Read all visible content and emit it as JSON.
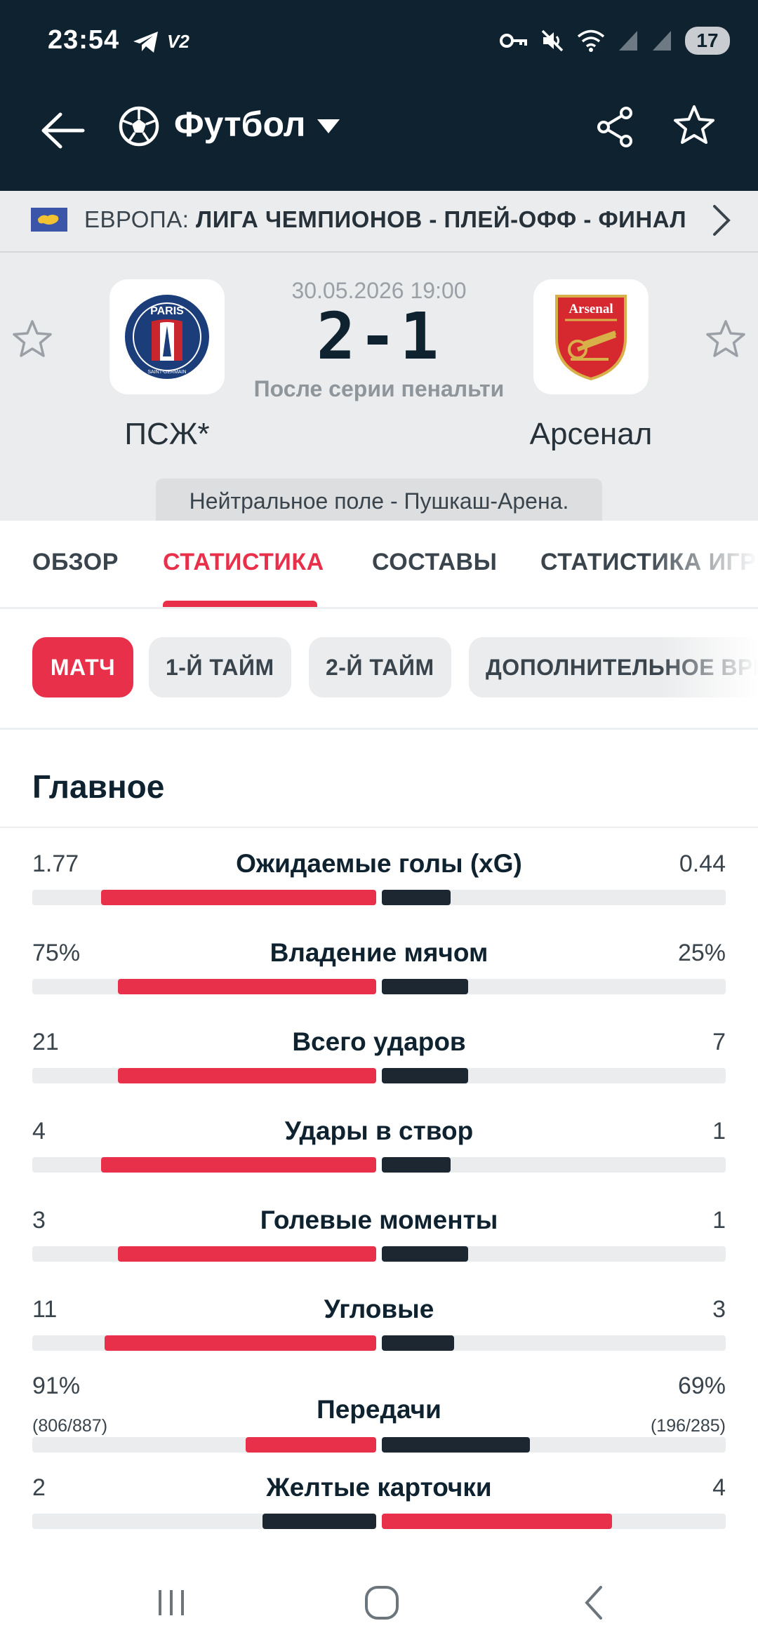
{
  "status": {
    "time": "23:54",
    "v2": "V2",
    "battery": "17"
  },
  "header": {
    "title": "Футбол",
    "icons": [
      "back-arrow-icon",
      "soccer-ball-icon",
      "dropdown-caret-icon",
      "share-icon",
      "star-icon"
    ]
  },
  "breadcrumb": {
    "region": "ЕВРОПА: ",
    "competition": "ЛИГА ЧЕМПИОНОВ - ПЛЕЙ-ОФФ - ФИНАЛ"
  },
  "match": {
    "date": "30.05.2026 19:00",
    "score": "2-1",
    "note": "После серии пенальти",
    "home": {
      "name": "ПСЖ*",
      "logo_text": "PARIS",
      "logo_sub": "SAINT-GERMAIN"
    },
    "away": {
      "name": "Арсенал",
      "logo_text": "Arsenal"
    },
    "venue": "Нейтральное поле - Пушкаш-Арена."
  },
  "tabs": [
    {
      "label": "ОБЗОР",
      "active": false
    },
    {
      "label": "СТАТИСТИКА",
      "active": true
    },
    {
      "label": "СОСТАВЫ",
      "active": false
    },
    {
      "label": "СТАТИСТИКА ИГРОКОВ",
      "active": false
    }
  ],
  "chips": [
    {
      "label": "МАТЧ",
      "active": true
    },
    {
      "label": "1-Й ТАЙМ",
      "active": false
    },
    {
      "label": "2-Й ТАЙМ",
      "active": false
    },
    {
      "label": "ДОПОЛНИТЕЛЬНОЕ ВРЕМЯ",
      "active": false
    }
  ],
  "section_title": "Главное",
  "colors": {
    "accent": "#e8304a",
    "dark": "#1c2731",
    "header_bg": "#0f2230",
    "track": "#ebeced"
  },
  "stats": [
    {
      "label": "Ожидаемые голы (xG)",
      "home": "1.77",
      "away": "0.44",
      "home_share": 0.8,
      "away_share": 0.2,
      "leader": "home"
    },
    {
      "label": "Владение мячом",
      "home": "75%",
      "away": "25%",
      "home_share": 0.75,
      "away_share": 0.25,
      "leader": "home"
    },
    {
      "label": "Всего ударов",
      "home": "21",
      "away": "7",
      "home_share": 0.75,
      "away_share": 0.25,
      "leader": "home"
    },
    {
      "label": "Удары в створ",
      "home": "4",
      "away": "1",
      "home_share": 0.8,
      "away_share": 0.2,
      "leader": "home"
    },
    {
      "label": "Голевые моменты",
      "home": "3",
      "away": "1",
      "home_share": 0.75,
      "away_share": 0.25,
      "leader": "home"
    },
    {
      "label": "Угловые",
      "home": "11",
      "away": "3",
      "home_share": 0.79,
      "away_share": 0.21,
      "leader": "home"
    },
    {
      "label": "Передачи",
      "home": "91%",
      "away": "69%",
      "home_sub": "(806/887)",
      "away_sub": "(196/285)",
      "home_share": 0.38,
      "away_share": 0.43,
      "leader": "home"
    },
    {
      "label": "Желтые карточки",
      "home": "2",
      "away": "4",
      "home_share": 0.33,
      "away_share": 0.67,
      "leader": "away"
    }
  ]
}
